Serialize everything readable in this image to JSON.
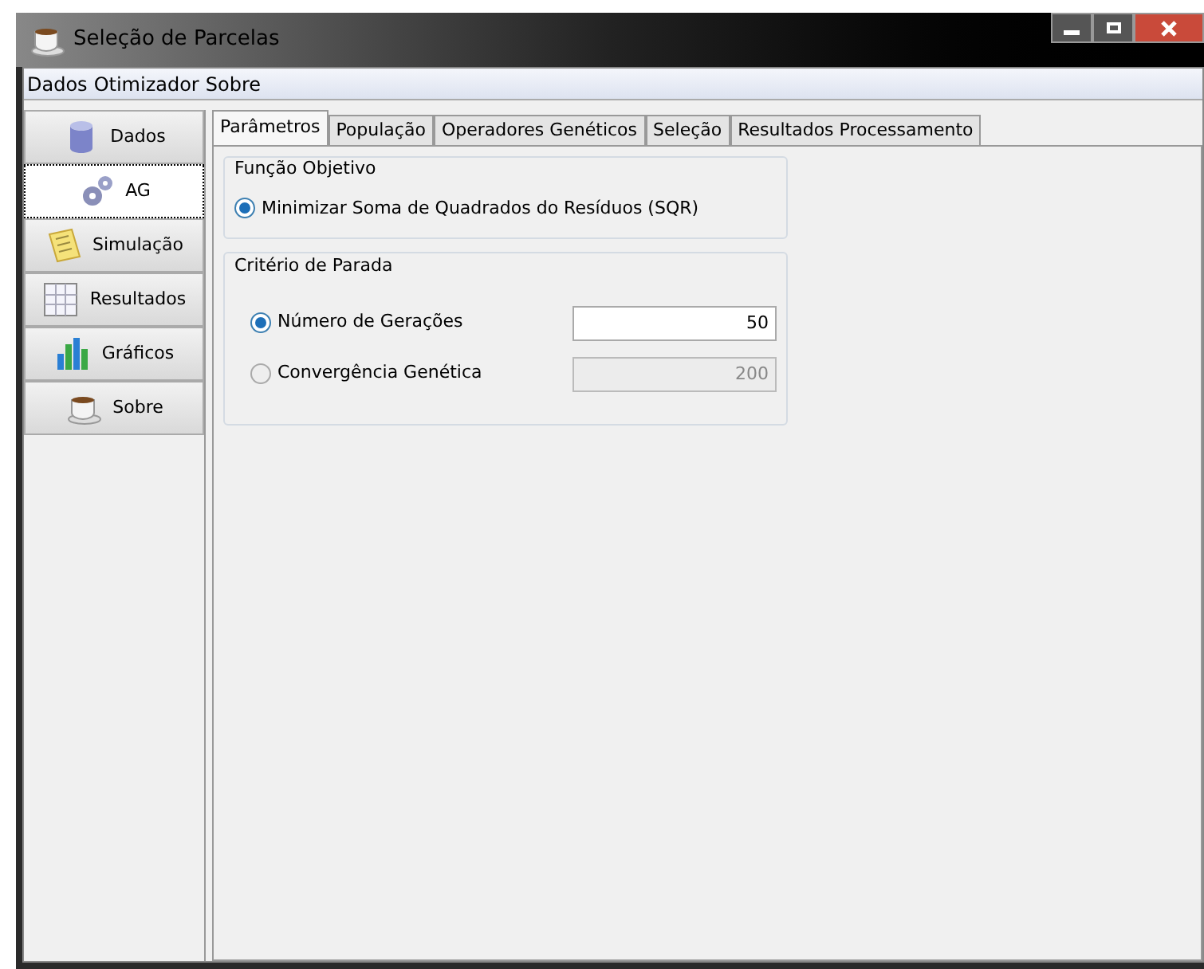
{
  "window": {
    "title": "Seleção de Parcelas"
  },
  "menu": [
    "Dados",
    "Otimizador",
    "Sobre"
  ],
  "sidebar": {
    "items": [
      {
        "label": "Dados",
        "kind": "database",
        "selected": false
      },
      {
        "label": "AG",
        "kind": "gears",
        "selected": true
      },
      {
        "label": "Simulação",
        "kind": "note",
        "selected": false
      },
      {
        "label": "Resultados",
        "kind": "grid",
        "selected": false
      },
      {
        "label": "Gráficos",
        "kind": "bars",
        "selected": false
      },
      {
        "label": "Sobre",
        "kind": "cup",
        "selected": false
      }
    ]
  },
  "tabs": [
    {
      "label": "Parâmetros",
      "selected": true
    },
    {
      "label": "População",
      "selected": false
    },
    {
      "label": "Operadores Genéticos",
      "selected": false
    },
    {
      "label": "Seleção",
      "selected": false
    },
    {
      "label": "Resultados Processamento",
      "selected": false
    }
  ],
  "objective": {
    "title": "Função Objetivo",
    "options": [
      {
        "label": "Minimizar Soma de Quadrados do Resíduos (SQR)",
        "selected": true
      }
    ]
  },
  "stop": {
    "title": "Critério de Parada",
    "options": [
      {
        "label": "Número de Gerações",
        "selected": true,
        "value": "50",
        "disabled": false
      },
      {
        "label": "Convergência Genética",
        "selected": false,
        "value": "200",
        "disabled": true
      }
    ]
  }
}
